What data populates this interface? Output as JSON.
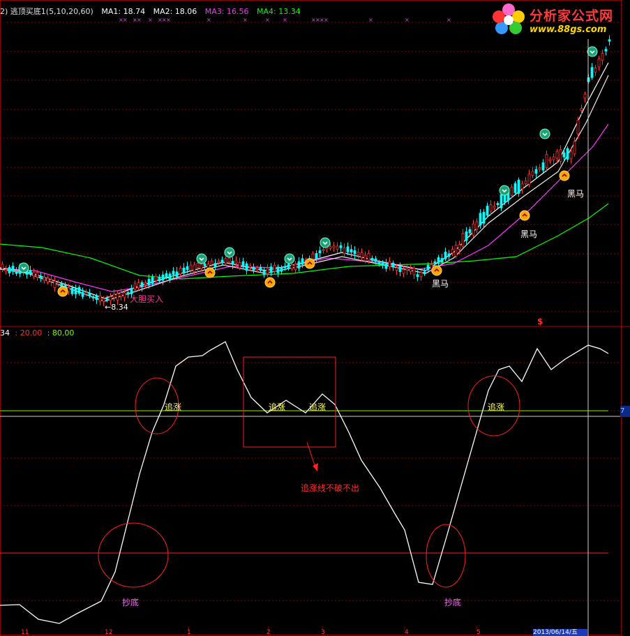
{
  "header": {
    "indicator_name": "2) 逃顶买底1(5,10,20,60)",
    "ma1": "MA1: 18.74",
    "ma2": "MA2: 18.06",
    "ma3": "MA3: 16.56",
    "ma4": "MA4: 13.34"
  },
  "logo": {
    "title": "分析家公式网",
    "url": "www.88gs.com"
  },
  "sub_header": {
    "prefix": "34",
    "v1": ": 20.00",
    "v2": ": 80.00"
  },
  "annotations": {
    "low_price": "←8.34",
    "buy_label": "大胆买入",
    "dark_horse": "黑马",
    "chase": "追涨",
    "note": "追涨线不破不出",
    "bottom": "抄底",
    "dollar": "$",
    "axis_value": "7",
    "date": "2013/06/14/五"
  },
  "x_axis_labels": [
    "11",
    "12",
    "1",
    "2",
    "3",
    "4",
    "5"
  ],
  "colors": {
    "ma1": "#ffffff",
    "ma2": "#ffff00",
    "ma3": "#ff33ff",
    "ma4": "#00ff00",
    "grid": "#8b0000",
    "candle_up": "#ff3333",
    "candle_down": "#00ffff",
    "line_80": "#7cfc00",
    "line_20": "#ff0000"
  },
  "chart_data": {
    "type": "line",
    "series": [
      {
        "name": "MA3",
        "values": [
          16.56
        ]
      },
      {
        "name": "MA4",
        "values": [
          13.34
        ]
      }
    ],
    "reference_lines": [
      20,
      80
    ]
  }
}
